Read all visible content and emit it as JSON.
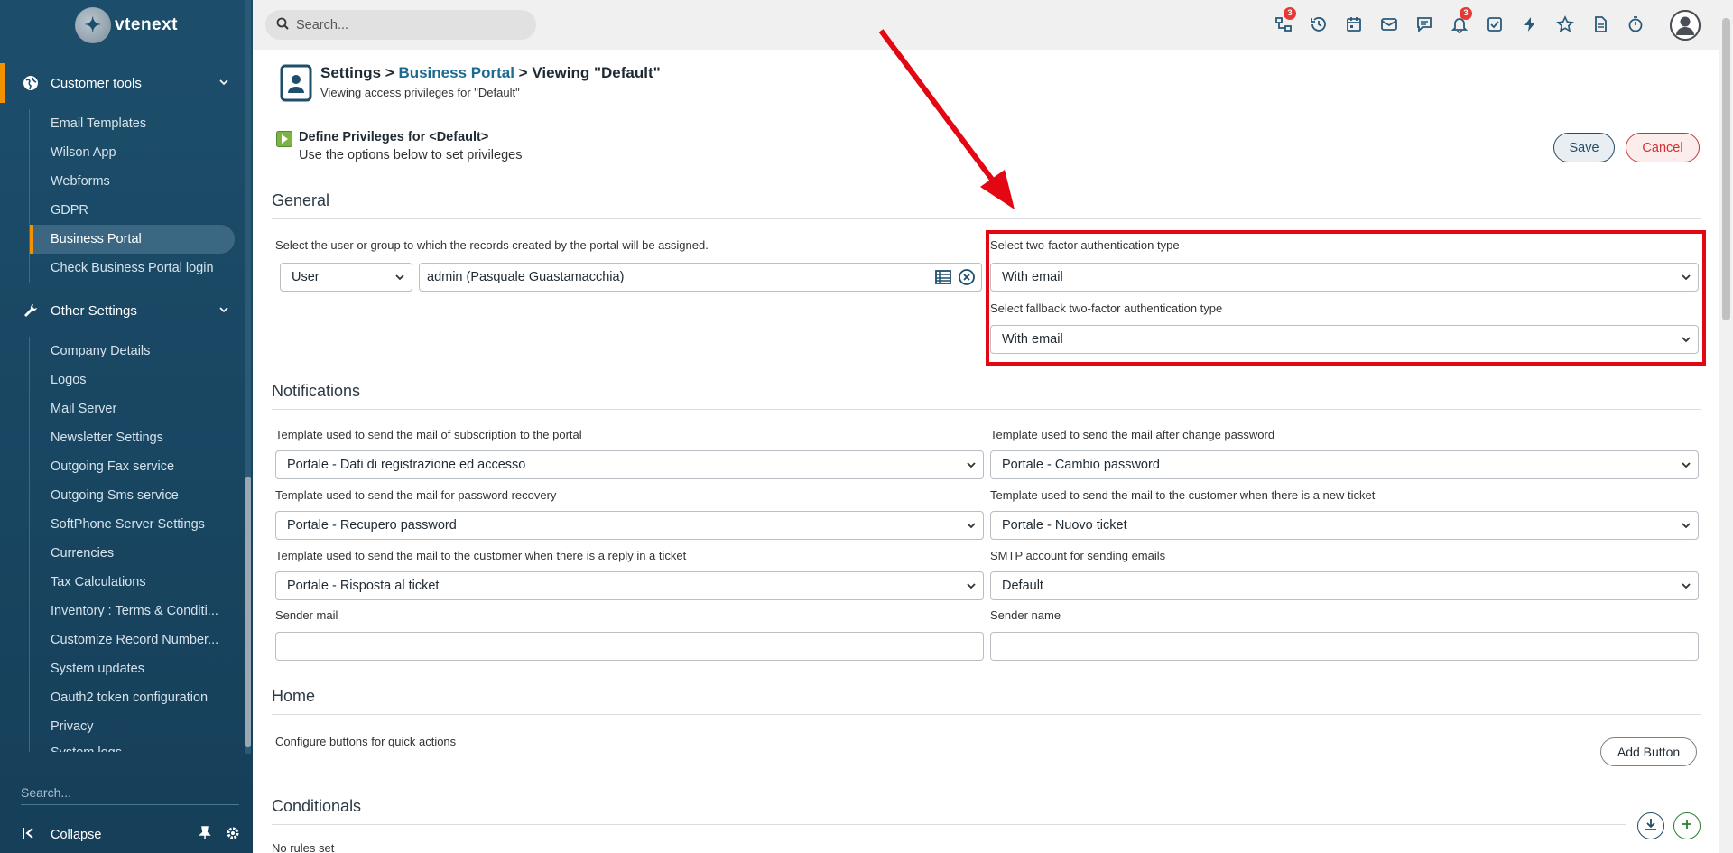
{
  "app": {
    "logo_text": "vtenext"
  },
  "sidebar": {
    "section1": {
      "label": "Customer tools"
    },
    "items1": [
      "Email Templates",
      "Wilson App",
      "Webforms",
      "GDPR",
      "Business Portal",
      "Check Business Portal login"
    ],
    "section2": {
      "label": "Other Settings"
    },
    "items2": [
      "Company Details",
      "Logos",
      "Mail Server",
      "Newsletter Settings",
      "Outgoing Fax service",
      "Outgoing Sms service",
      "SoftPhone Server Settings",
      "Currencies",
      "Tax Calculations",
      "Inventory : Terms & Conditi...",
      "Customize Record Number...",
      "System updates",
      "Oauth2 token configuration",
      "Privacy",
      "System logs"
    ],
    "search_placeholder": "Search...",
    "collapse_label": "Collapse"
  },
  "topbar": {
    "search_placeholder": "Search...",
    "badges": {
      "network": "3",
      "bell": "3"
    }
  },
  "header": {
    "crumb_settings": "Settings",
    "crumb_sep1": " > ",
    "crumb_portal": "Business Portal",
    "crumb_sep2": " > ",
    "crumb_view": "Viewing \"Default\"",
    "subtitle": "Viewing access privileges for \"Default\""
  },
  "privileges": {
    "title": "Define Privileges for <Default>",
    "subtitle": "Use the options below to set privileges",
    "save_label": "Save",
    "cancel_label": "Cancel"
  },
  "general": {
    "title": "General",
    "assign_label": "Select the user or group to which the records created by the portal will be assigned.",
    "assign_type": "User",
    "assign_value": "admin (Pasquale Guastamacchia)",
    "twofa_label": "Select two-factor authentication type",
    "twofa_value": "With email",
    "fallback_label": "Select fallback two-factor authentication type",
    "fallback_value": "With email"
  },
  "notifications": {
    "title": "Notifications",
    "sub_label": "Template used to send the mail of subscription to the portal",
    "sub_value": "Portale - Dati di registrazione ed accesso",
    "chg_label": "Template used to send the mail after change password",
    "chg_value": "Portale - Cambio password",
    "rec_label": "Template used to send the mail for password recovery",
    "rec_value": "Portale - Recupero password",
    "new_label": "Template used to send the mail to the customer when there is a new ticket",
    "new_value": "Portale - Nuovo ticket",
    "reply_label": "Template used to send the mail to the customer when there is a reply in a ticket",
    "reply_value": "Portale - Risposta al ticket",
    "smtp_label": "SMTP account for sending emails",
    "smtp_value": "Default",
    "sender_mail_label": "Sender mail",
    "sender_mail_value": "",
    "sender_name_label": "Sender name",
    "sender_name_value": ""
  },
  "home": {
    "title": "Home",
    "configure_label": "Configure buttons for quick actions",
    "add_button_label": "Add Button"
  },
  "conditionals": {
    "title": "Conditionals",
    "empty_label": "No rules set"
  },
  "colors": {
    "accent": "#f39200",
    "sidebar": "#1c4e6b",
    "highlight": "#e30613"
  }
}
